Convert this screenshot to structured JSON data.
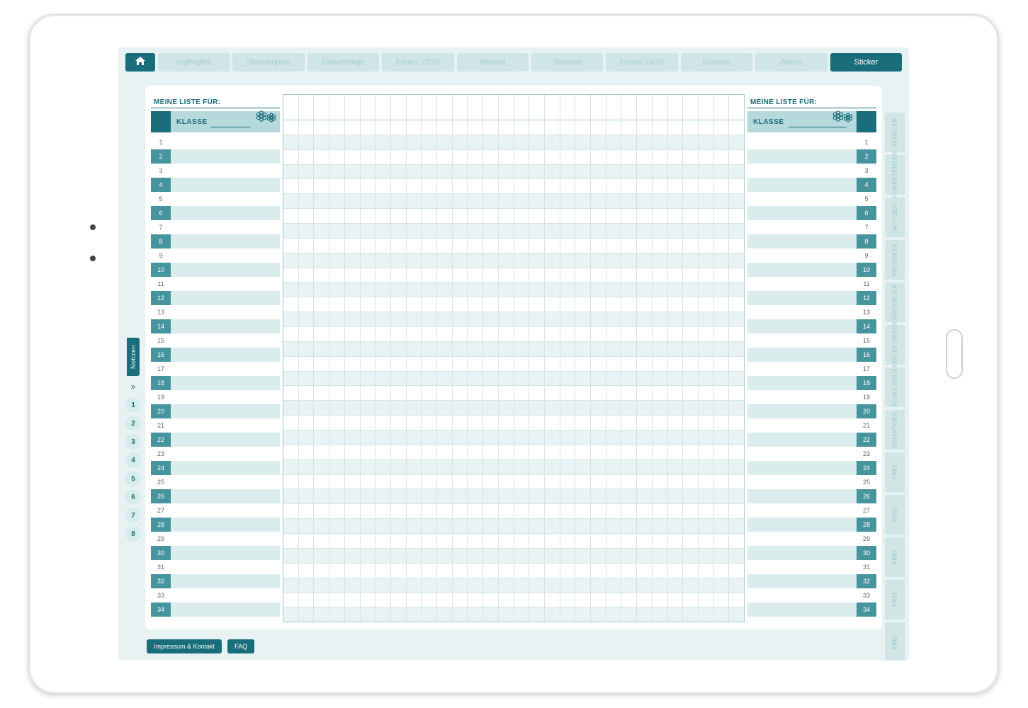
{
  "nav": {
    "home_icon": "home",
    "tabs": [
      {
        "label": "Highlights",
        "active": false
      },
      {
        "label": "Stundenplan",
        "active": false
      },
      {
        "label": "Geburtstage",
        "active": false
      },
      {
        "label": "Ferien 22/23",
        "active": false
      },
      {
        "label": "Monate",
        "active": false
      },
      {
        "label": "Wochen",
        "active": false
      },
      {
        "label": "Ferien 23/24",
        "active": false
      },
      {
        "label": "Klassen",
        "active": false
      },
      {
        "label": "Noten",
        "active": false
      },
      {
        "label": "Sticker",
        "active": true
      }
    ]
  },
  "list_left": {
    "title": "MEINE LISTE FÜR:",
    "klasse_label": "KLASSE",
    "klasse_value": "",
    "row_count": 34
  },
  "list_right": {
    "title": "MEINE LISTE FÜR:",
    "klasse_label": "KLASSE",
    "klasse_value": "",
    "row_count": 34
  },
  "grid": {
    "columns": 30,
    "rows": 34
  },
  "left_side": {
    "notizen_label": "Notizen",
    "chevron": "»",
    "page_numbers": [
      "1",
      "2",
      "3",
      "4",
      "5",
      "6",
      "7",
      "8"
    ]
  },
  "right_side": {
    "tabs": [
      {
        "label": "SCHÜLER"
      },
      {
        "label": "KOMPETENZEN"
      },
      {
        "label": "NOTIZEN"
      },
      {
        "label": "PROJEKTE"
      },
      {
        "label": "RÜCKBLICK"
      },
      {
        "label": "REFLEKTIEREN"
      },
      {
        "label": "SCHULGELD"
      },
      {
        "label": "SONSTIGES"
      },
      {
        "label": "FREI"
      },
      {
        "label": "FREI"
      },
      {
        "label": "FREI"
      },
      {
        "label": "FREI"
      },
      {
        "label": "FREI"
      }
    ]
  },
  "footer": {
    "impressum": "Impressum & Kontakt",
    "faq": "FAQ"
  }
}
